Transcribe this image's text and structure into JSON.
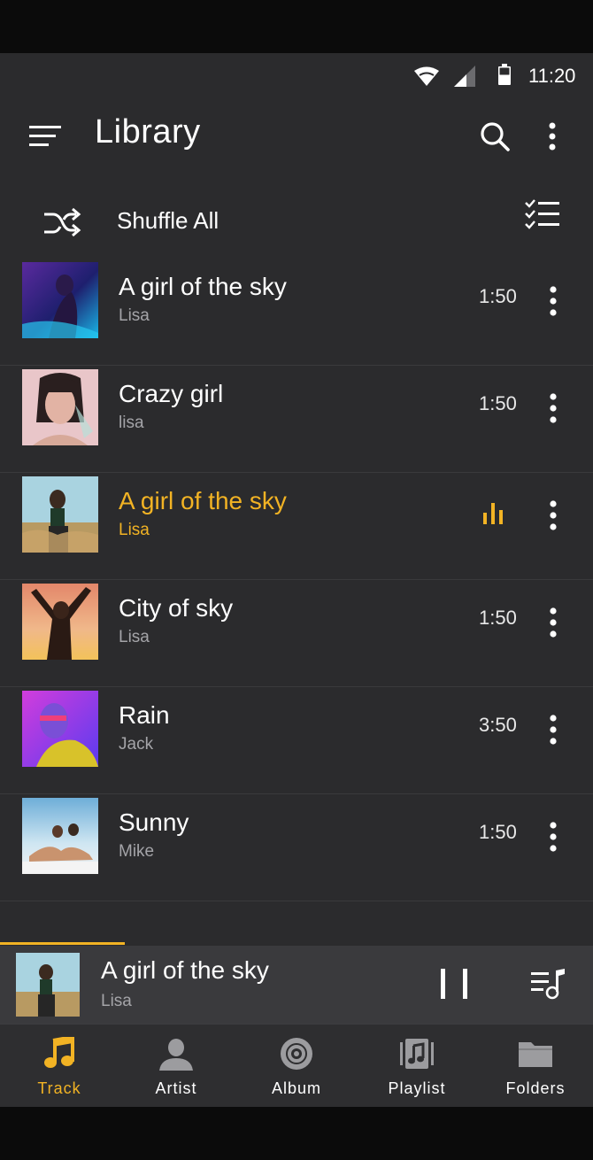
{
  "status_bar": {
    "time": "11:20"
  },
  "header": {
    "title": "Library",
    "icons": [
      "menu-icon",
      "search-icon",
      "more-vertical-icon"
    ]
  },
  "shuffle": {
    "label": "Shuffle All",
    "icon": "shuffle-icon",
    "select_icon": "checklist-icon"
  },
  "tracks": [
    {
      "title": "A girl of the sky",
      "artist": "Lisa",
      "duration": "1:50",
      "active": false
    },
    {
      "title": "Crazy girl",
      "artist": "lisa",
      "duration": "1:50",
      "active": false
    },
    {
      "title": "A girl of the sky",
      "artist": "Lisa",
      "duration": "",
      "active": true
    },
    {
      "title": "City of sky",
      "artist": "Lisa",
      "duration": "1:50",
      "active": false
    },
    {
      "title": "Rain",
      "artist": "Jack",
      "duration": "3:50",
      "active": false
    },
    {
      "title": "Sunny",
      "artist": "Mike",
      "duration": "1:50",
      "active": false
    }
  ],
  "now_playing": {
    "title": "A girl of the sky",
    "artist": "Lisa",
    "progress": 0.21,
    "icons": [
      "pause-icon",
      "queue-music-icon"
    ]
  },
  "nav": {
    "items": [
      {
        "label": "Track",
        "icon": "music-note-icon",
        "active": true
      },
      {
        "label": "Artist",
        "icon": "person-icon",
        "active": false
      },
      {
        "label": "Album",
        "icon": "album-disc-icon",
        "active": false
      },
      {
        "label": "Playlist",
        "icon": "playlist-icon",
        "active": false
      },
      {
        "label": "Folders",
        "icon": "folder-icon",
        "active": false
      }
    ]
  },
  "colors": {
    "accent": "#f2b324",
    "background": "#2b2b2d",
    "secondary_text": "#a4a4a8"
  }
}
